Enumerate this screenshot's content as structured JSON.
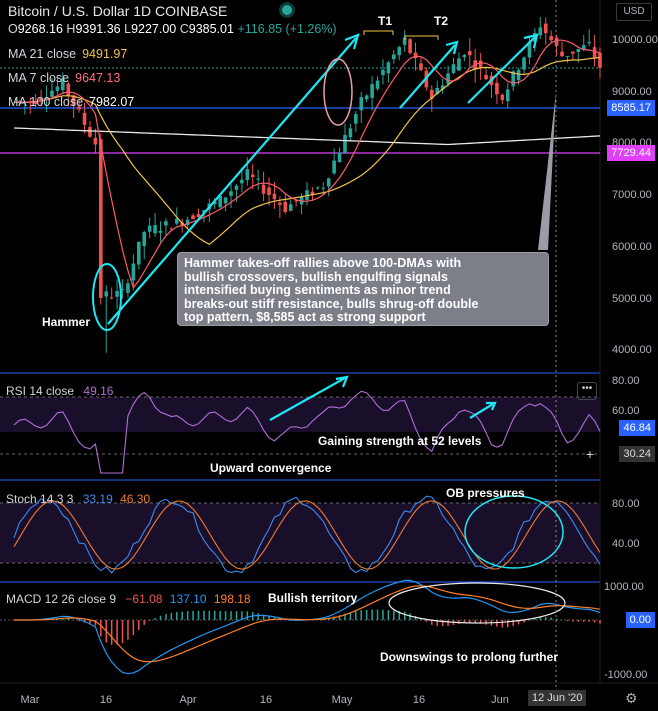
{
  "header": {
    "title": "Bitcoin / U.S. Dollar  1D  COINBASE",
    "ohlc": {
      "O": "9268.16",
      "H": "9391.36",
      "L": "9227.00",
      "C": "9385.01",
      "change": "+116.85 (+1.26%)"
    },
    "currency_button": "USD",
    "ma_rows": [
      {
        "label": "MA 21 close",
        "value": "9491.97",
        "color": "#f0c24a"
      },
      {
        "label": "MA 7 close",
        "value": "9647.13",
        "color": "#ff6e79"
      },
      {
        "label": "MA 100 close",
        "value": "7982.07",
        "color": "#ffffff"
      }
    ]
  },
  "annotation": {
    "lines": [
      "Hammer takes-off rallies above 100-DMAs with",
      "bullish crossovers, bullish engulfing signals",
      "intensified buying sentiments as minor trend",
      "breaks-out stiff resistance, bulls shrug-off double",
      "top pattern, $8,585 act as strong support"
    ]
  },
  "labels": {
    "hammer": "Hammer",
    "t1": "T1",
    "t2": "T2",
    "rsi_note": "Gaining strength at 52 levels",
    "upward": "Upward convergence",
    "ob": "OB pressures",
    "bullish": "Bullish territory",
    "downswings": "Downswings to prolong further"
  },
  "rsi": {
    "label": "RSI 14 close",
    "value": "49.16",
    "tag1": "46.84",
    "tag2": "30.24"
  },
  "stoch": {
    "label": "Stoch 14 3 3",
    "k": "33.19",
    "d": "46.30"
  },
  "macd": {
    "label": "MACD 12 26 close 9",
    "hist": "−61.08",
    "macd": "137.10",
    "signal": "198.18",
    "tag": "0.00"
  },
  "price_tags": {
    "support": "8585.17",
    "line": "7729.44"
  },
  "date_tag": "12 Jun '20",
  "colors": {
    "up": "#26a69a",
    "down": "#ef5350",
    "ma21": "#f0c24a",
    "ma7": "#ff5a6a",
    "ma100": "#e8e8e8",
    "trend": "#00e5ff",
    "rsi": "#b06fd6",
    "stoch_k": "#3d8bf2",
    "stoch_d": "#f07b2f",
    "macd": "#2196f3",
    "signal": "#ff7f27",
    "support": "#2962ff",
    "magenta": "#e040fb"
  },
  "chart_data": {
    "type": "line",
    "x_ticks": [
      "Mar",
      "16",
      "Apr",
      "16",
      "May",
      "16",
      "Jun"
    ],
    "price_axis": [
      "10000.00",
      "9000.00",
      "8000.00",
      "7000.00",
      "6000.00",
      "5000.00",
      "4000.00"
    ],
    "rsi_axis": [
      "80.00",
      "60.00",
      "40.00",
      "20.00"
    ],
    "stoch_axis": [
      "80.00",
      "40.00"
    ],
    "macd_axis": [
      "1000.00",
      "-1000.00"
    ],
    "ylim_price": [
      3600,
      10450
    ],
    "approx_close_path": [
      {
        "date": "2020-02-28",
        "close": 8700
      },
      {
        "date": "2020-03-05",
        "close": 9050
      },
      {
        "date": "2020-03-11",
        "close": 7900
      },
      {
        "date": "2020-03-12",
        "close": 4950
      },
      {
        "date": "2020-03-16",
        "close": 5000
      },
      {
        "date": "2020-03-20",
        "close": 6200
      },
      {
        "date": "2020-03-27",
        "close": 6400
      },
      {
        "date": "2020-04-03",
        "close": 6800
      },
      {
        "date": "2020-04-08",
        "close": 7300
      },
      {
        "date": "2020-04-15",
        "close": 6650
      },
      {
        "date": "2020-04-22",
        "close": 7100
      },
      {
        "date": "2020-04-29",
        "close": 8700
      },
      {
        "date": "2020-05-07",
        "close": 9900
      },
      {
        "date": "2020-05-12",
        "close": 8800
      },
      {
        "date": "2020-05-18",
        "close": 9700
      },
      {
        "date": "2020-05-25",
        "close": 8800
      },
      {
        "date": "2020-06-01",
        "close": 10200
      },
      {
        "date": "2020-06-05",
        "close": 9600
      },
      {
        "date": "2020-06-10",
        "close": 9800
      },
      {
        "date": "2020-06-12",
        "close": 9385
      }
    ]
  }
}
